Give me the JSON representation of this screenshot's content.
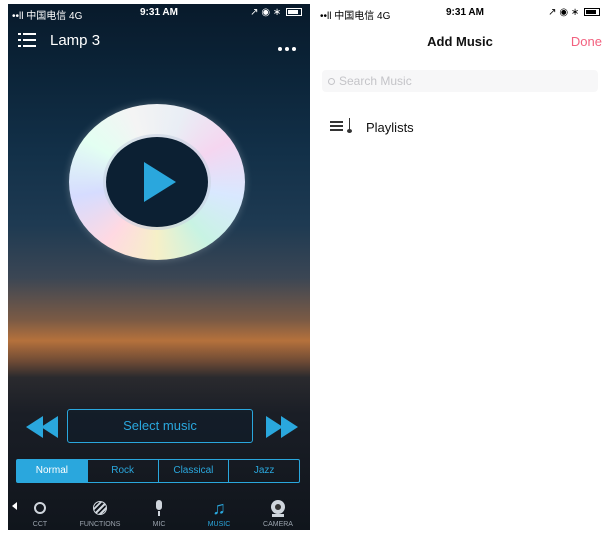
{
  "left_screen": {
    "status_bar": {
      "carrier": "••ll 中国电信 4G",
      "time": "9:31 AM",
      "icons": "↗ ◉ ∗"
    },
    "nav": {
      "title": "Lamp 3"
    },
    "player": {
      "select_label": "Select music"
    },
    "genres": [
      {
        "label": "Normal",
        "active": true
      },
      {
        "label": "Rock",
        "active": false
      },
      {
        "label": "Classical",
        "active": false
      },
      {
        "label": "Jazz",
        "active": false
      }
    ],
    "tabs": [
      {
        "label": "CCT",
        "icon": "cct-icon"
      },
      {
        "label": "FUNCTIONS",
        "icon": "functions-icon"
      },
      {
        "label": "MIC",
        "icon": "mic-icon"
      },
      {
        "label": "MUSIC",
        "icon": "music-note-icon",
        "active": true
      },
      {
        "label": "CAMERA",
        "icon": "camera-icon"
      }
    ],
    "accent": "#2aa7dd"
  },
  "right_screen": {
    "status_bar": {
      "carrier": "••ll 中国电信 4G",
      "time": "9:31 AM",
      "icons": "↗ ◉ ∗"
    },
    "header": {
      "title": "Add Music",
      "done_label": "Done"
    },
    "search": {
      "placeholder": "Search Music"
    },
    "rows": [
      {
        "label": "Playlists",
        "icon": "playlist-icon"
      }
    ],
    "accent": "#f2617f"
  }
}
